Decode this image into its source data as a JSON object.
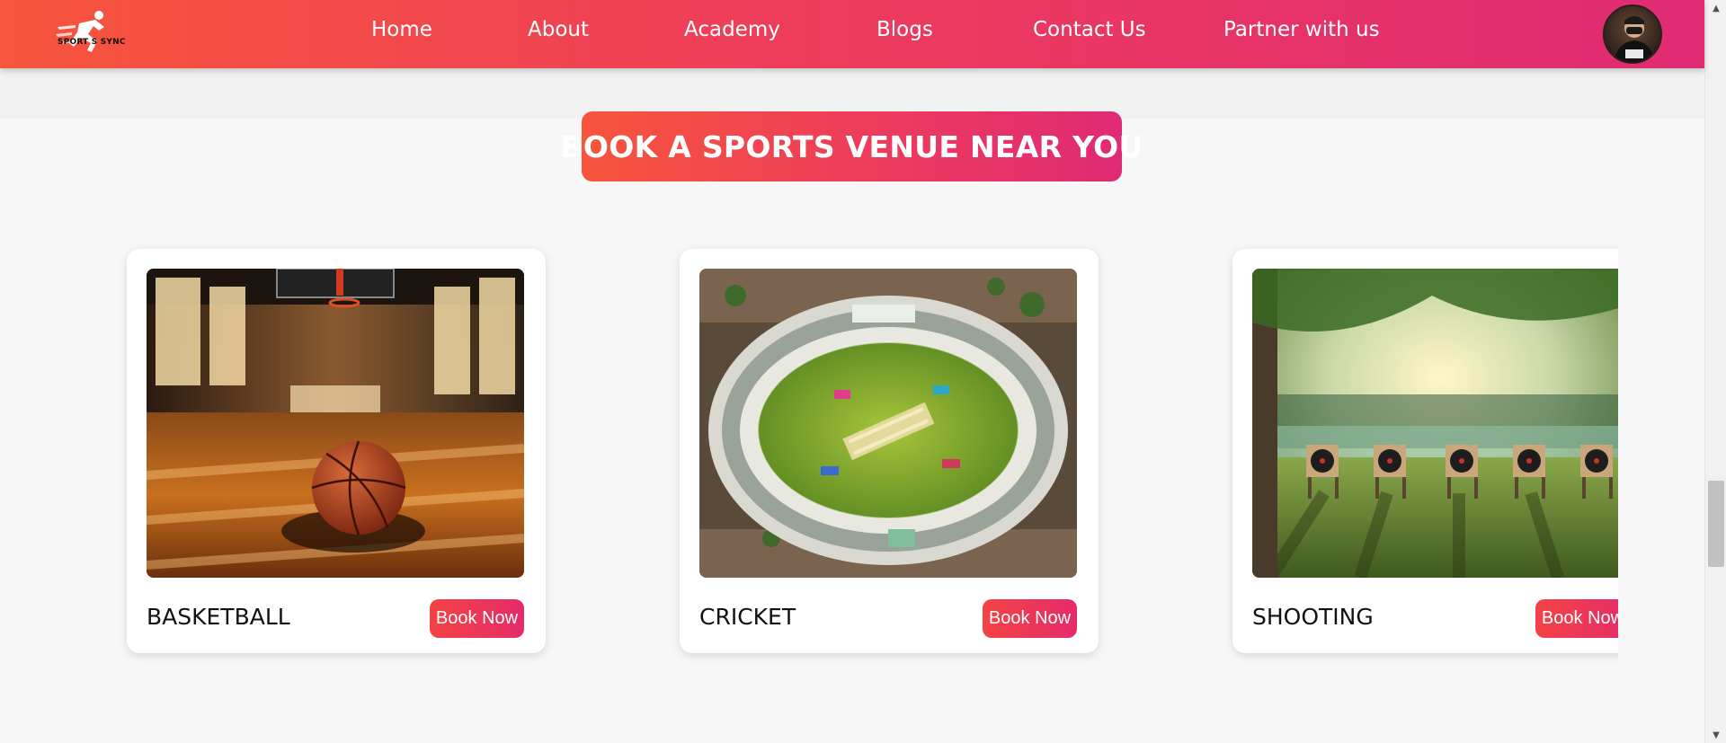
{
  "navbar": {
    "logo_text": "SPORT S SYNC",
    "links": [
      {
        "label": "Home"
      },
      {
        "label": "About"
      },
      {
        "label": "Academy"
      },
      {
        "label": "Blogs"
      },
      {
        "label": "Contact Us"
      },
      {
        "label": "Partner with us"
      }
    ]
  },
  "section": {
    "heading": "BOOK A SPORTS VENUE NEAR YOU"
  },
  "venues": [
    {
      "title": "BASKETBALL",
      "button": "Book Now",
      "image": "basketball-court"
    },
    {
      "title": "CRICKET",
      "button": "Book Now",
      "image": "cricket-stadium"
    },
    {
      "title": "SHOOTING",
      "button": "Book Now",
      "image": "shooting-range"
    }
  ],
  "colors": {
    "brand_start": "#f7553c",
    "brand_end": "#e02a74",
    "background": "#f7f7f7"
  }
}
